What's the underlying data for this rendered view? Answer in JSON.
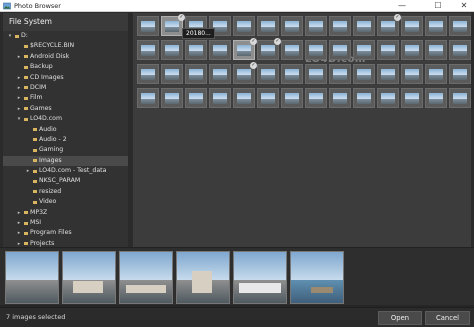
{
  "window": {
    "title": "Photo Browser",
    "min_glyph": "—",
    "max_glyph": "☐",
    "close_glyph": "✕"
  },
  "sidebar": {
    "header": "File System",
    "items": [
      {
        "label": "D:",
        "depth": 0,
        "arrow": "expanded"
      },
      {
        "label": "$RECYCLE.BIN",
        "depth": 1,
        "arrow": "none"
      },
      {
        "label": "Android Disk",
        "depth": 1,
        "arrow": "collapsed"
      },
      {
        "label": "Backup",
        "depth": 1,
        "arrow": "none"
      },
      {
        "label": "CD Images",
        "depth": 1,
        "arrow": "collapsed"
      },
      {
        "label": "DCIM",
        "depth": 1,
        "arrow": "collapsed"
      },
      {
        "label": "Film",
        "depth": 1,
        "arrow": "collapsed"
      },
      {
        "label": "Games",
        "depth": 1,
        "arrow": "collapsed"
      },
      {
        "label": "LO4D.com",
        "depth": 1,
        "arrow": "expanded"
      },
      {
        "label": "Audio",
        "depth": 2,
        "arrow": "none"
      },
      {
        "label": "Audio - 2",
        "depth": 2,
        "arrow": "none"
      },
      {
        "label": "Gaming",
        "depth": 2,
        "arrow": "none"
      },
      {
        "label": "Images",
        "depth": 2,
        "arrow": "none",
        "selected": true
      },
      {
        "label": "LO4D.com - Test_data",
        "depth": 2,
        "arrow": "collapsed"
      },
      {
        "label": "NKSC_PARAM",
        "depth": 2,
        "arrow": "none"
      },
      {
        "label": "resized",
        "depth": 2,
        "arrow": "none"
      },
      {
        "label": "Video",
        "depth": 2,
        "arrow": "none"
      },
      {
        "label": "MP3Z",
        "depth": 1,
        "arrow": "collapsed"
      },
      {
        "label": "MSI",
        "depth": 1,
        "arrow": "collapsed"
      },
      {
        "label": "Program Files",
        "depth": 1,
        "arrow": "collapsed"
      },
      {
        "label": "Projects",
        "depth": 1,
        "arrow": "collapsed"
      }
    ]
  },
  "grid": {
    "tooltip": "20180...",
    "watermark": "LO4D.com",
    "checked_indices": [
      1,
      10,
      18,
      19,
      32
    ],
    "highlighted_indices": [
      1,
      18
    ]
  },
  "status": {
    "selected_text": "7 images selected"
  },
  "buttons": {
    "open": "Open",
    "cancel": "Cancel"
  },
  "colors": {
    "accent": "#d9b560",
    "background": "#2b2b2b",
    "panel": "#3c3c3c"
  },
  "icons": {
    "expanded": "▾",
    "collapsed": "▸",
    "check": "✓"
  }
}
